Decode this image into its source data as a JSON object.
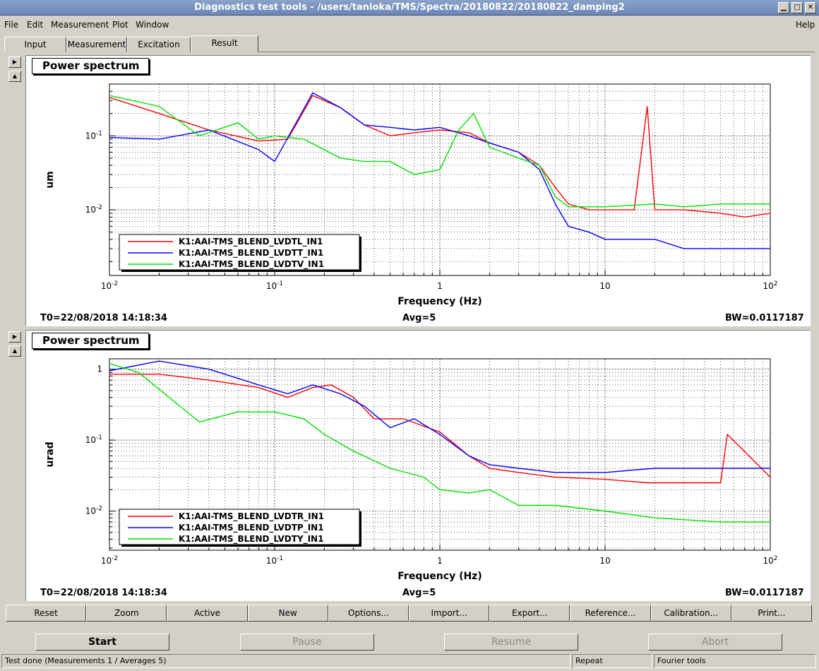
{
  "window": {
    "title": "Diagnostics test tools - /users/tanioka/TMS/Spectra/20180822/20180822_damping2"
  },
  "menu": {
    "file": "File",
    "edit": "Edit",
    "measurement": "Measurement",
    "plot": "Plot",
    "window": "Window",
    "help": "Help"
  },
  "tabs": [
    "Input",
    "Measurement",
    "Excitation",
    "Result"
  ],
  "colors": {
    "red": "#ff0000",
    "blue": "#0000ff",
    "green": "#00e000"
  },
  "plots": [
    {
      "title": "Power spectrum",
      "ylabel": "um",
      "xlabel": "Frequency (Hz)",
      "yticks": [
        "10^-1",
        "10^-2"
      ],
      "xticks": [
        "10^-2",
        "10^-1",
        "1",
        "10",
        "10^2"
      ],
      "legend": [
        "K1:AAI-TMS_BLEND_LVDTL_IN1",
        "K1:AAI-TMS_BLEND_LVDTT_IN1",
        "K1:AAI-TMS_BLEND_LVDTV_IN1"
      ],
      "t0": "T0=22/08/2018 14:18:34",
      "avg": "Avg=5",
      "bw": "BW=0.0117187"
    },
    {
      "title": "Power spectrum",
      "ylabel": "urad",
      "xlabel": "Frequency (Hz)",
      "yticks": [
        "1",
        "10^-1",
        "10^-2"
      ],
      "xticks": [
        "10^-2",
        "10^-1",
        "1",
        "10",
        "10^2"
      ],
      "legend": [
        "K1:AAI-TMS_BLEND_LVDTR_IN1",
        "K1:AAI-TMS_BLEND_LVDTP_IN1",
        "K1:AAI-TMS_BLEND_LVDTY_IN1"
      ],
      "t0": "T0=22/08/2018 14:18:34",
      "avg": "Avg=5",
      "bw": "BW=0.0117187"
    }
  ],
  "chart_data": [
    {
      "type": "line",
      "title": "Power spectrum",
      "xlabel": "Frequency (Hz)",
      "ylabel": "um",
      "xscale": "log",
      "yscale": "log",
      "xlim": [
        0.01,
        100
      ],
      "ylim": [
        0.0013,
        0.5
      ],
      "grid": true,
      "legend_placement": "bottom-left",
      "series": [
        {
          "name": "K1:AAI-TMS_BLEND_LVDTL_IN1",
          "color": "#ff0000",
          "x": [
            0.01,
            0.02,
            0.04,
            0.08,
            0.12,
            0.17,
            0.25,
            0.35,
            0.5,
            0.7,
            1,
            1.5,
            2,
            3,
            4,
            5,
            6,
            8,
            10,
            15,
            18,
            20,
            30,
            50,
            70,
            100
          ],
          "y": [
            0.33,
            0.2,
            0.12,
            0.085,
            0.09,
            0.35,
            0.24,
            0.14,
            0.1,
            0.11,
            0.12,
            0.11,
            0.08,
            0.06,
            0.04,
            0.02,
            0.012,
            0.01,
            0.01,
            0.01,
            0.25,
            0.01,
            0.01,
            0.009,
            0.008,
            0.009
          ]
        },
        {
          "name": "K1:AAI-TMS_BLEND_LVDTT_IN1",
          "color": "#0000ff",
          "x": [
            0.01,
            0.02,
            0.04,
            0.08,
            0.1,
            0.17,
            0.25,
            0.35,
            0.5,
            0.7,
            1,
            1.5,
            2,
            3,
            4,
            5,
            6,
            8,
            10,
            20,
            30,
            50,
            70,
            100
          ],
          "y": [
            0.095,
            0.09,
            0.12,
            0.065,
            0.045,
            0.38,
            0.24,
            0.14,
            0.13,
            0.12,
            0.13,
            0.1,
            0.08,
            0.06,
            0.035,
            0.012,
            0.006,
            0.005,
            0.004,
            0.004,
            0.003,
            0.003,
            0.003,
            0.003
          ]
        },
        {
          "name": "K1:AAI-TMS_BLEND_LVDTV_IN1",
          "color": "#00e000",
          "x": [
            0.01,
            0.02,
            0.035,
            0.06,
            0.08,
            0.1,
            0.15,
            0.25,
            0.35,
            0.5,
            0.7,
            1,
            1.3,
            1.6,
            2,
            3,
            4,
            5,
            6,
            10,
            20,
            30,
            50,
            100
          ],
          "y": [
            0.35,
            0.25,
            0.1,
            0.15,
            0.09,
            0.1,
            0.09,
            0.05,
            0.045,
            0.045,
            0.03,
            0.035,
            0.12,
            0.2,
            0.07,
            0.05,
            0.04,
            0.015,
            0.011,
            0.011,
            0.012,
            0.011,
            0.012,
            0.012
          ]
        }
      ]
    },
    {
      "type": "line",
      "title": "Power spectrum",
      "xlabel": "Frequency (Hz)",
      "ylabel": "urad",
      "xscale": "log",
      "yscale": "log",
      "xlim": [
        0.01,
        100
      ],
      "ylim": [
        0.0028,
        1.4
      ],
      "grid": true,
      "legend_placement": "bottom-left",
      "series": [
        {
          "name": "K1:AAI-TMS_BLEND_LVDTR_IN1",
          "color": "#ff0000",
          "x": [
            0.01,
            0.02,
            0.04,
            0.08,
            0.12,
            0.17,
            0.22,
            0.3,
            0.4,
            0.6,
            1,
            1.5,
            2,
            3,
            5,
            10,
            18,
            30,
            50,
            55,
            100
          ],
          "y": [
            0.85,
            0.85,
            0.7,
            0.55,
            0.4,
            0.55,
            0.6,
            0.4,
            0.2,
            0.2,
            0.13,
            0.06,
            0.04,
            0.035,
            0.03,
            0.028,
            0.025,
            0.025,
            0.025,
            0.12,
            0.03
          ]
        },
        {
          "name": "K1:AAI-TMS_BLEND_LVDTP_IN1",
          "color": "#0000ff",
          "x": [
            0.01,
            0.02,
            0.04,
            0.08,
            0.12,
            0.17,
            0.25,
            0.35,
            0.5,
            0.7,
            1,
            1.5,
            2,
            3,
            5,
            10,
            20,
            50,
            100
          ],
          "y": [
            0.95,
            1.3,
            1.0,
            0.6,
            0.45,
            0.6,
            0.45,
            0.3,
            0.15,
            0.2,
            0.12,
            0.06,
            0.045,
            0.04,
            0.035,
            0.035,
            0.04,
            0.04,
            0.04
          ]
        },
        {
          "name": "K1:AAI-TMS_BLEND_LVDTY_IN1",
          "color": "#00e000",
          "x": [
            0.01,
            0.015,
            0.035,
            0.06,
            0.1,
            0.15,
            0.2,
            0.3,
            0.5,
            0.8,
            1,
            1.5,
            2,
            3,
            5,
            10,
            20,
            50,
            100
          ],
          "y": [
            1.2,
            0.9,
            0.18,
            0.25,
            0.25,
            0.2,
            0.12,
            0.07,
            0.04,
            0.03,
            0.02,
            0.018,
            0.02,
            0.012,
            0.012,
            0.01,
            0.008,
            0.007,
            0.007
          ]
        }
      ]
    }
  ],
  "buttons": [
    "Reset",
    "Zoom",
    "Active",
    "New",
    "Options...",
    "Import...",
    "Export...",
    "Reference...",
    "Calibration...",
    "Print..."
  ],
  "controls": {
    "start": "Start",
    "pause": "Pause",
    "resume": "Resume",
    "abort": "Abort"
  },
  "status": {
    "message": "Test done (Measurements 1 / Averages 5)",
    "repeat": "Repeat",
    "tool": "Fourier tools"
  }
}
